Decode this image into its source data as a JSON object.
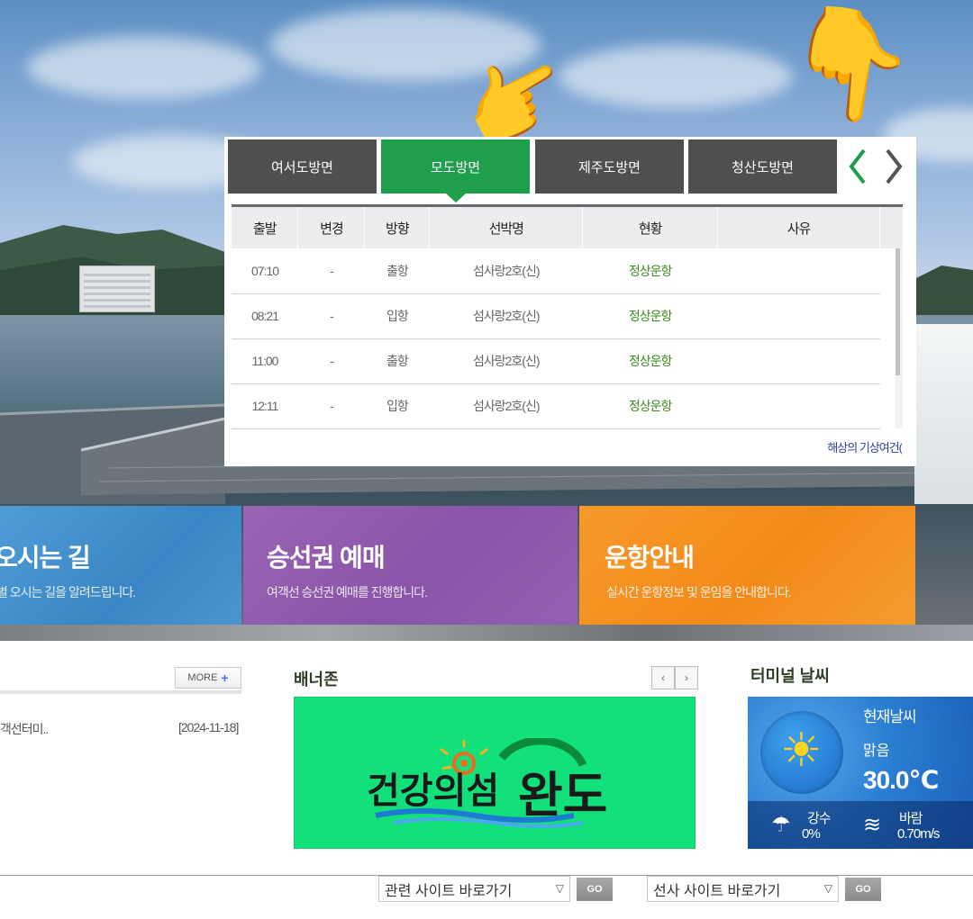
{
  "ferry": {
    "tabs": [
      {
        "label": "여서도방면",
        "active": false
      },
      {
        "label": "모도방면",
        "active": true
      },
      {
        "label": "제주도방면",
        "active": false
      },
      {
        "label": "청산도방면",
        "active": false
      }
    ],
    "columns": [
      "출발",
      "변경",
      "방향",
      "선박명",
      "현황",
      "사유"
    ],
    "rows": [
      {
        "departure": "07:10",
        "change": "-",
        "direction": "출항",
        "ship": "섬사랑2호(신)",
        "status": "정상운항",
        "reason": ""
      },
      {
        "departure": "08:21",
        "change": "-",
        "direction": "입항",
        "ship": "섬사랑2호(신)",
        "status": "정상운항",
        "reason": ""
      },
      {
        "departure": "11:00",
        "change": "-",
        "direction": "출항",
        "ship": "섬사랑2호(신)",
        "status": "정상운항",
        "reason": ""
      },
      {
        "departure": "12:11",
        "change": "-",
        "direction": "입항",
        "ship": "섬사랑2호(신)",
        "status": "정상운항",
        "reason": ""
      }
    ],
    "notice": "해상의 기상여건(",
    "status_color": "#3d8b1f",
    "active_tab_color": "#1f9e4b"
  },
  "features": [
    {
      "title": "오시는 길",
      "subtitle": "별 오시는 길을 알려드립니다."
    },
    {
      "title": "승선권 예매",
      "subtitle": "여객선 승선권 예매를 진행합니다."
    },
    {
      "title": "운항안내",
      "subtitle": "실시간 운항정보 및 운임을 안내합니다."
    }
  ],
  "notices": {
    "more_label": "MORE",
    "item": "객선터미..",
    "date": "[2024-11-18]"
  },
  "banner": {
    "title": "배너존",
    "logo_text": "건강의섬 완도"
  },
  "weather": {
    "title": "터미널 날씨",
    "current_label": "현재날씨",
    "condition": "맑음",
    "temperature": "30.0℃",
    "rain_label": "강수",
    "rain_value": "0%",
    "wind_label": "바람",
    "wind_value": "0.70m/s"
  },
  "footer": {
    "related_select": "관련 사이트 바로가기",
    "shipping_select": "선사 사이트 바로가기",
    "go_label": "GO"
  }
}
